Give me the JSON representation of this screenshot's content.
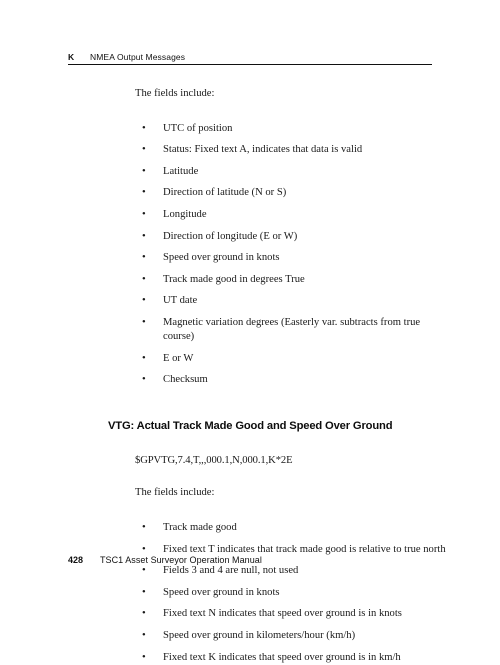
{
  "header": {
    "appendix_letter": "K",
    "title": "NMEA Output Messages"
  },
  "body": {
    "first_list": {
      "lead_in": "The fields include:",
      "bullet_glyph": "•",
      "items": [
        "UTC of position",
        "Status: Fixed text A, indicates that data is valid",
        "Latitude",
        "Direction of latitude (N or S)",
        "Longitude",
        "Direction of longitude (E or W)",
        "Speed over ground in knots",
        "Track made good in degrees True",
        "UT date",
        "Magnetic variation degrees (Easterly var. subtracts from true course)",
        "E or W",
        "Checksum"
      ]
    },
    "section": {
      "heading": "VTG: Actual Track Made Good and Speed Over Ground",
      "sentence": "$GPVTG,7.4,T,,,000.1,N,000.1,K*2E",
      "lead_in": "The fields include:",
      "bullet_glyph": "•",
      "items": [
        "Track made good",
        "Fixed text T indicates that track made good is relative to true north",
        "Fields 3 and 4 are null, not used",
        "Speed over ground in knots",
        "Fixed text N indicates that speed over ground is in knots",
        "Speed over ground in kilometers/hour (km/h)",
        "Fixed text K indicates that speed over ground is in km/h"
      ]
    }
  },
  "footer": {
    "page_number": "428",
    "manual_title": "TSC1 Asset Surveyor Operation Manual"
  },
  "colors": {
    "text": "#1a1a1a",
    "rule": "#111111",
    "background": "#ffffff"
  }
}
